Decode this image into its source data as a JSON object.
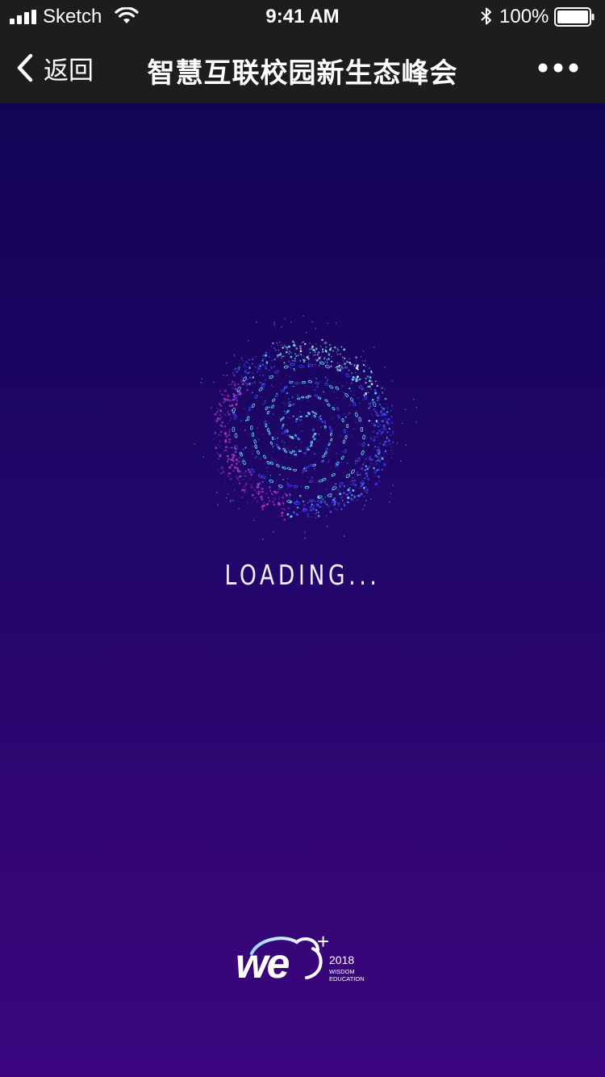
{
  "status_bar": {
    "carrier": "Sketch",
    "time": "9:41 AM",
    "battery_percent": "100%",
    "battery_level": 1.0,
    "signal_bars": 4
  },
  "nav_bar": {
    "back_label": "返回",
    "title": "智慧互联校园新生态峰会",
    "more_icon": "more-horizontal-icon"
  },
  "main": {
    "loading_text": "LOADING...",
    "spinner_icon": "particle-swirl-icon"
  },
  "logo": {
    "brand": "we",
    "plus": "+",
    "year": "2018",
    "line1": "WISDOM",
    "line2": "EDUCATION"
  },
  "colors": {
    "bar_background": "#1d1d20",
    "content_top": "#120455",
    "content_bottom": "#3b0680",
    "particle_blue": "#3d4bff",
    "particle_cyan": "#6fe3ff",
    "particle_pink": "#c03cd8"
  }
}
